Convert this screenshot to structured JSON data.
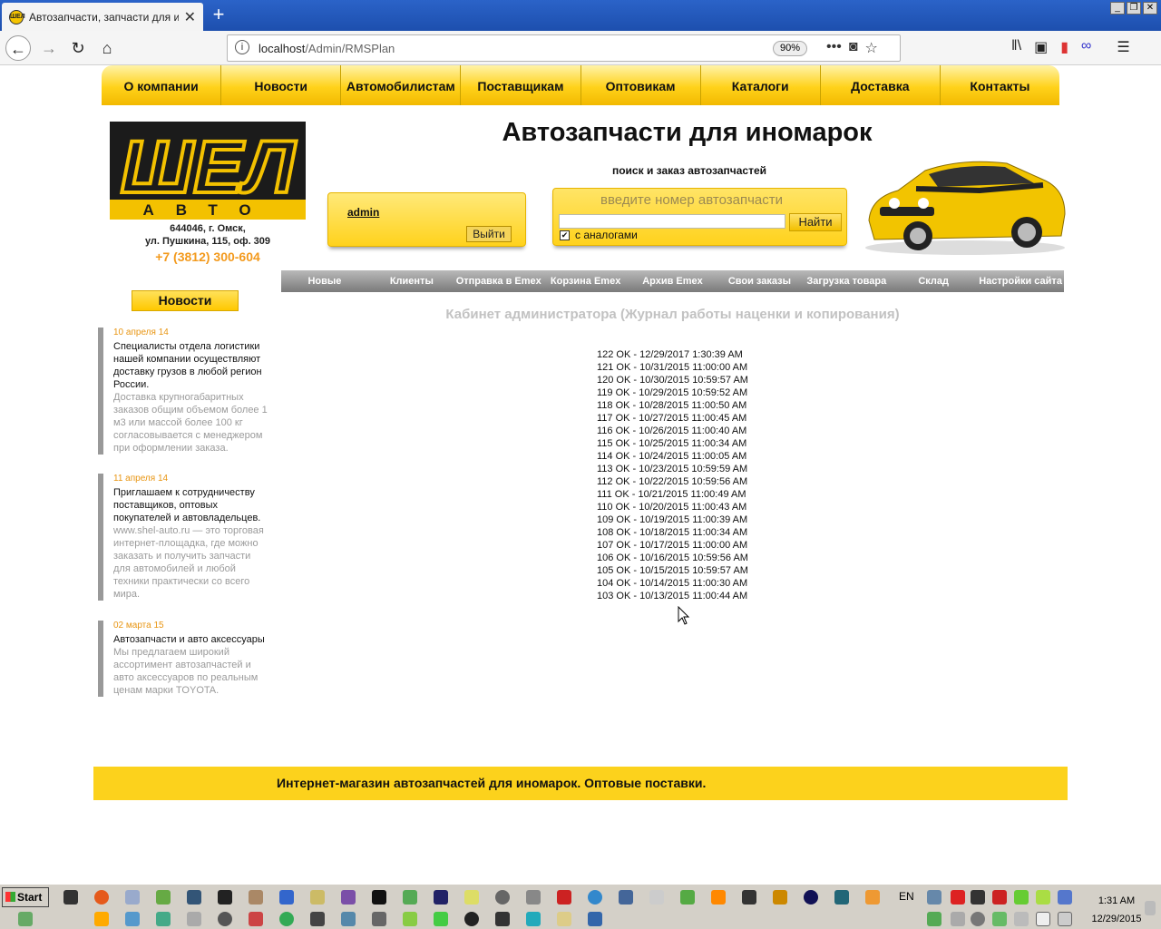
{
  "browser": {
    "tab_title": "Автозапчасти, запчасти для ино",
    "tab_favicon": "ШЕЛ",
    "url_host": "localhost",
    "url_path": "/Admin/RMSPlan",
    "zoom": "90%"
  },
  "topnav": [
    "О компании",
    "Новости",
    "Автомобилистам",
    "Поставщикам",
    "Оптовикам",
    "Каталоги",
    "Доставка",
    "Контакты"
  ],
  "header": {
    "logo_text": "ШЕЛ",
    "logo_sub": "АВТО",
    "address_line1": "644046, г. Омск,",
    "address_line2": "ул. Пушкина, 115, оф. 309",
    "phone": "+7 (3812) 300-604",
    "headline": "Автозапчасти для иномарок",
    "subline": "поиск и заказ автозапчастей"
  },
  "user": {
    "name": "admin",
    "logout": "Выйти"
  },
  "search": {
    "label": "введите номер автозапчасти",
    "button": "Найти",
    "analogs": "с аналогами",
    "analogs_checked": true
  },
  "admin_menu": [
    "Новые",
    "Клиенты",
    "Отправка в Emex",
    "Корзина Emex",
    "Архив Emex",
    "Свои заказы",
    "Загрузка товара",
    "Склад",
    "Настройки сайта"
  ],
  "page_title": "Кабинет администратора (Журнал работы наценки и копирования)",
  "news": {
    "button": "Новости",
    "items": [
      {
        "date": "10 апреля 14",
        "head": "Специалисты отдела логистики нашей компании осуществляют доставку грузов в любой регион России.",
        "body": "Доставка крупногабаритных заказов общим объемом более 1 м3 или массой более 100 кг согласовывается с менеджером при оформлении заказа."
      },
      {
        "date": "11 апреля 14",
        "head": "Приглашаем к сотрудничеству поставщиков, оптовых покупателей и автовладельцев.",
        "body": "www.shel-auto.ru — это торговая интернет-площадка, где можно заказать и получить запчасти для автомобилей и любой техники практически со всего мира."
      },
      {
        "date": "02 марта 15",
        "head": "Автозапчасти и авто аксессуары",
        "body": "Мы предлагаем широкий ассортимент автозапчастей и авто аксессуаров по реальным ценам марки TOYOTA."
      }
    ]
  },
  "log": [
    "122 OK - 12/29/2017 1:30:39 AM",
    "121 OK - 10/31/2015 11:00:00 AM",
    "120 OK - 10/30/2015 10:59:57 AM",
    "119 OK - 10/29/2015 10:59:52 AM",
    "118 OK - 10/28/2015 11:00:50 AM",
    "117 OK - 10/27/2015 11:00:45 AM",
    "116 OK - 10/26/2015 11:00:40 AM",
    "115 OK - 10/25/2015 11:00:34 AM",
    "114 OK - 10/24/2015 11:00:05 AM",
    "113 OK - 10/23/2015 10:59:59 AM",
    "112 OK - 10/22/2015 10:59:56 AM",
    "111 OK - 10/21/2015 11:00:49 AM",
    "110 OK - 10/20/2015 11:00:43 AM",
    "109 OK - 10/19/2015 11:00:39 AM",
    "108 OK - 10/18/2015 11:00:34 AM",
    "107 OK - 10/17/2015 11:00:00 AM",
    "106 OK - 10/16/2015 10:59:56 AM",
    "105 OK - 10/15/2015 10:59:57 AM",
    "104 OK - 10/14/2015 11:00:30 AM",
    "103 OK - 10/13/2015 11:00:44 AM"
  ],
  "footer": "Интернет-магазин автозапчастей для иномарок. Оптовые поставки.",
  "taskbar": {
    "start": "Start",
    "lang": "EN",
    "time": "1:31 AM",
    "date": "12/29/2015"
  },
  "colors": {
    "accent": "#ffd21c",
    "menu_gray": "#8a8a8a",
    "phone": "#f39a1d",
    "news_date": "#e89512"
  }
}
